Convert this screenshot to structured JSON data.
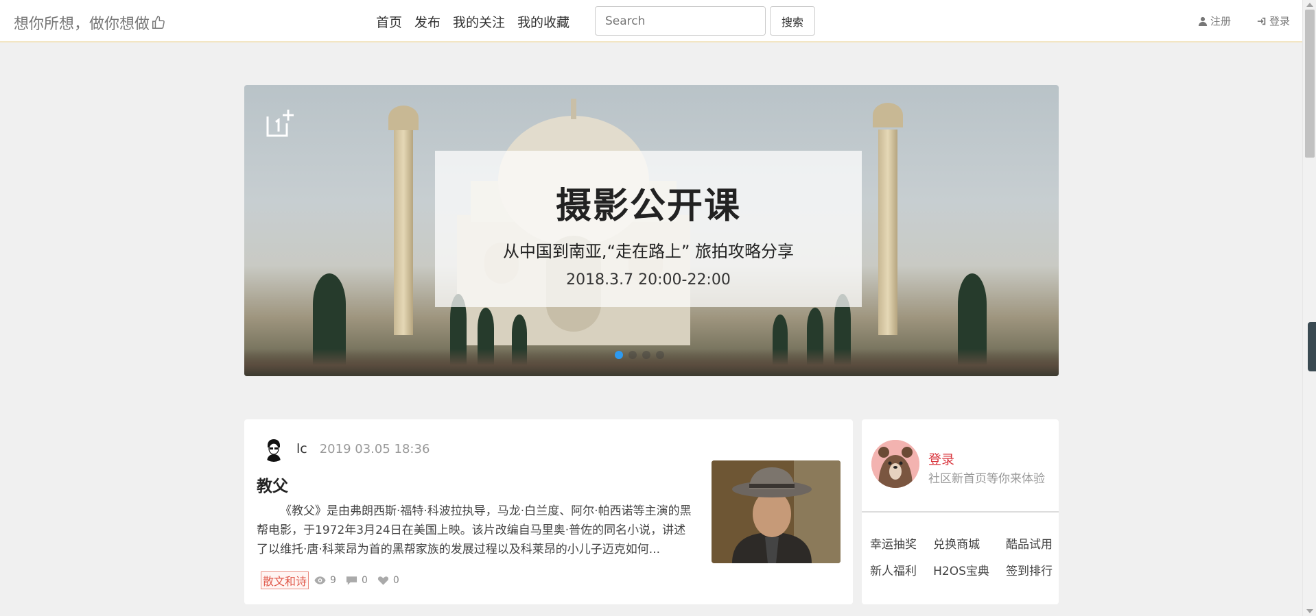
{
  "navbar": {
    "brand": "想你所想，做你想做",
    "links": [
      "首页",
      "发布",
      "我的关注",
      "我的收藏"
    ],
    "search_placeholder": "Search",
    "search_button": "搜索",
    "register": "注册",
    "login": "登录"
  },
  "banner": {
    "title": "摄影公开课",
    "subtitle": "从中国到南亚,“走在路上” 旅拍攻略分享",
    "date": "2018.3.7  20:00-22:00",
    "slide_count": 4,
    "active_slide": 1
  },
  "post": {
    "author": "lc",
    "time": "2019 03.05 18:36",
    "title": "教父",
    "excerpt": "《教父》是由弗朗西斯·福特·科波拉执导，马龙·白兰度、阿尔·帕西诺等主演的黑帮电影，于1972年3月24日在美国上映。该片改编自马里奥·普佐的同名小说，讲述了以维托·唐·科莱昂为首的黑帮家族的发展过程以及科莱昂的小儿子迈克如何...",
    "tag": "散文和诗",
    "views": "9",
    "comments": "0",
    "likes": "0"
  },
  "sidebar": {
    "login": "登录",
    "description": "社区新首页等你来体验",
    "links": [
      "幸运抽奖",
      "兑换商城",
      "酷品试用",
      "新人福利",
      "H2OS宝典",
      "签到排行"
    ]
  },
  "colors": {
    "accent_red": "#d9363e",
    "tag_red": "#e0584a",
    "active_dot": "#2d9af0"
  }
}
